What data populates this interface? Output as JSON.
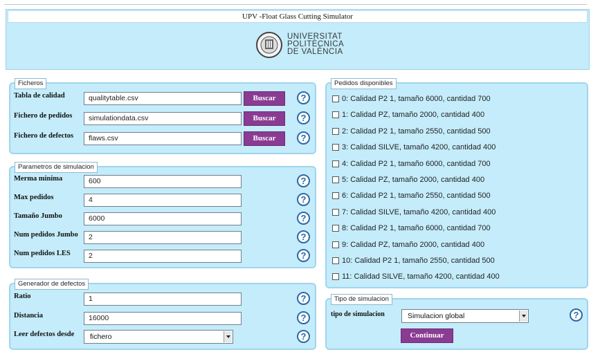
{
  "window": {
    "title": "UPV -Float Glass Cutting Simulator"
  },
  "logo": {
    "line1": "UNIVERSITAT",
    "line2": "POLITÈCNICA",
    "line3": "DE VALÈNCIA"
  },
  "ficheros": {
    "legend": "Ficheros",
    "rows": [
      {
        "label": "Tabla de calidad",
        "value": "qualitytable.csv",
        "button": "Buscar"
      },
      {
        "label": "Fichero de pedidos",
        "value": "simulationdata.csv",
        "button": "Buscar"
      },
      {
        "label": "Fichero de defectos",
        "value": "flaws.csv",
        "button": "Buscar"
      }
    ]
  },
  "parametros": {
    "legend": "Parametros de simulacion",
    "rows": [
      {
        "label": "Merma minima",
        "value": "600"
      },
      {
        "label": "Max pedidos",
        "value": "4"
      },
      {
        "label": "Tamaño Jumbo",
        "value": "6000"
      },
      {
        "label": "Num pedidos Jumbo",
        "value": "2"
      },
      {
        "label": "Num pedidos LES",
        "value": "2"
      }
    ]
  },
  "generador": {
    "legend": "Generador de defectos",
    "rows": [
      {
        "label": "Ratio",
        "value": "1"
      },
      {
        "label": "Distancia",
        "value": "16000"
      },
      {
        "label": "Leer defectos desde",
        "value": "fichero"
      }
    ]
  },
  "pedidos": {
    "legend": "Pedidos disponibles",
    "items": [
      "0: Calidad P2 1, tamaño 6000, cantidad 700",
      "1: Calidad PZ, tamaño 2000, cantidad 400",
      "2: Calidad P2 1, tamaño 2550, cantidad 500",
      "3: Calidad SILVE, tamaño 4200, cantidad 400",
      "4: Calidad P2 1, tamaño 6000, cantidad 700",
      "5: Calidad PZ, tamaño 2000, cantidad 400",
      "6: Calidad P2 1, tamaño 2550, cantidad 500",
      "7: Calidad SILVE, tamaño 4200, cantidad 400",
      "8: Calidad P2 1, tamaño 6000, cantidad 700",
      "9: Calidad PZ, tamaño 2000, cantidad 400",
      "10: Calidad P2 1, tamaño 2550, cantidad 500",
      "11: Calidad SILVE, tamaño 4200, cantidad 400"
    ]
  },
  "tipo": {
    "legend": "Tipo de simulacion",
    "label": "tipo de simulacion",
    "value": "Simulacion global",
    "button": "Continuar"
  },
  "help": {
    "glyph": "?",
    "icon": "help-icon"
  },
  "colors": {
    "panel": "#c4ecfb",
    "button": "#8a3c93",
    "help": "#2a6aa8"
  }
}
